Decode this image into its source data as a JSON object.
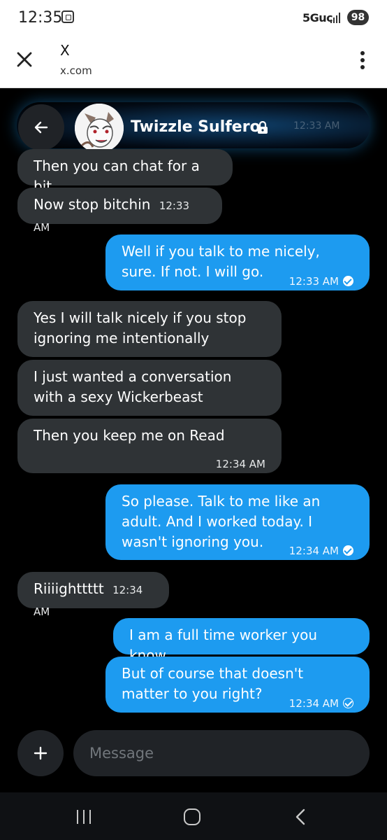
{
  "status": {
    "time": "12:35",
    "network": "5Guc",
    "battery": "98"
  },
  "browser": {
    "title": "X",
    "url": "x.com"
  },
  "chat": {
    "contact_name": "Twizzle Sulfero",
    "ghost_time": "12:33 AM"
  },
  "messages": [
    {
      "side": "in",
      "text": "Then you can chat for a bit",
      "time": ""
    },
    {
      "side": "in",
      "text": "Now stop bitchin",
      "time": "12:33 AM"
    },
    {
      "side": "out",
      "text": "Well if you talk to me nicely, sure. If not. I will go.",
      "time": "12:33 AM",
      "status": "seen"
    },
    {
      "side": "in",
      "text": "Yes I will talk nicely if you stop ignoring me intentionally",
      "time": ""
    },
    {
      "side": "in",
      "text": "I just wanted a conversation with a sexy Wickerbeast",
      "time": ""
    },
    {
      "side": "in",
      "text": "Then you keep me on Read",
      "time": "12:34 AM"
    },
    {
      "side": "out",
      "text": "So please. Talk to me like an adult. And I worked today. I wasn't ignoring you.",
      "time": "12:34 AM",
      "status": "seen"
    },
    {
      "side": "in",
      "text": "Riiiighttttt",
      "time": "12:34 AM"
    },
    {
      "side": "out",
      "text": "I am a full time worker you know.",
      "time": ""
    },
    {
      "side": "out",
      "text": "But of course that doesn't matter to you right?",
      "time": "12:34 AM",
      "status": "sent"
    }
  ],
  "composer": {
    "placeholder": "Message"
  },
  "colors": {
    "incoming": "#2f3336",
    "outgoing": "#1d9bf0",
    "background": "#000000"
  },
  "icons": [
    "close-icon",
    "more-vertical-icon",
    "back-arrow-icon",
    "lock-icon",
    "plus-icon",
    "read-check-icon",
    "sent-check-icon",
    "recent-apps-icon",
    "home-icon",
    "nav-back-icon"
  ]
}
